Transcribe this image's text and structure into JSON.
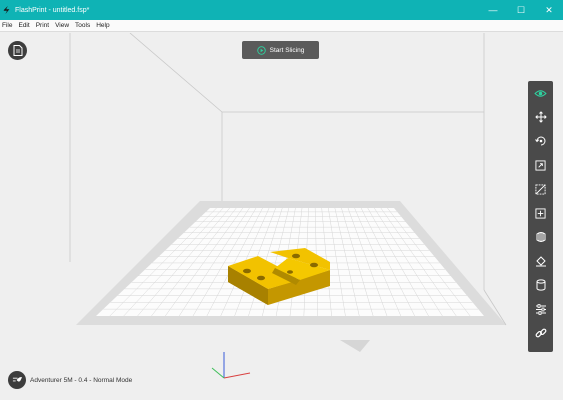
{
  "window": {
    "title": "FlashPrint - untitled.fsp*",
    "minimize_glyph": "—",
    "maximize_glyph": "☐",
    "close_glyph": "✕"
  },
  "menu": [
    "File",
    "Edit",
    "Print",
    "View",
    "Tools",
    "Help"
  ],
  "actions": {
    "start_slicing": "Start Slicing"
  },
  "toolbar": {
    "tools": [
      {
        "icon": "view-eye-icon",
        "active": true
      },
      {
        "icon": "move-icon"
      },
      {
        "icon": "rotate-icon"
      },
      {
        "icon": "scale-icon"
      },
      {
        "icon": "cut-icon"
      },
      {
        "icon": "add-support-icon"
      },
      {
        "icon": "extruder-icon"
      },
      {
        "icon": "paint-bucket-icon"
      },
      {
        "icon": "cylinder-icon"
      },
      {
        "icon": "settings-sliders-icon"
      },
      {
        "icon": "link-icon"
      }
    ]
  },
  "status": {
    "machine": "Adventurer 5M - 0.4 - Normal Mode"
  },
  "colors": {
    "titlebar": "#0fb3b5",
    "accent_green": "#2ed3a0",
    "model_yellow": "#f2c200",
    "toolbar_bg": "#4a4a4a",
    "button_bg": "#5a5a5a"
  }
}
